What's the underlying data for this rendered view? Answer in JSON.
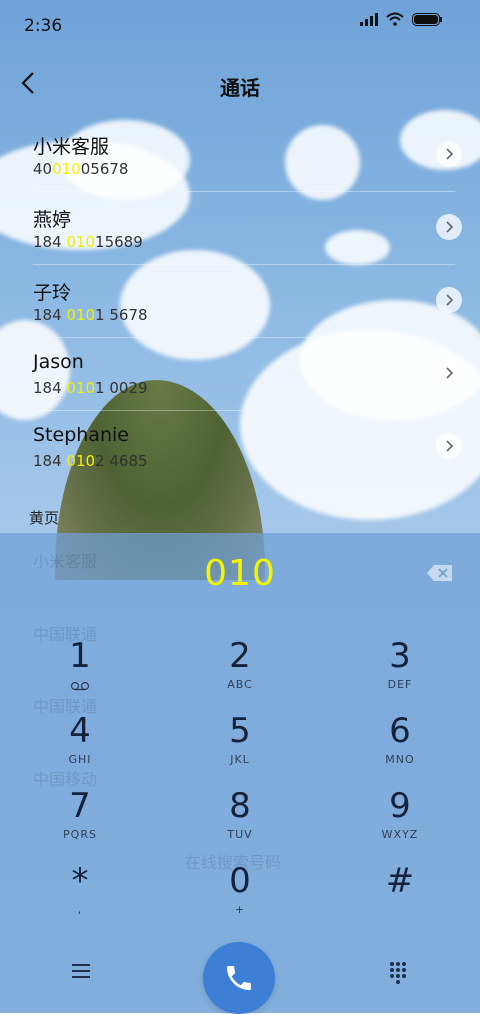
{
  "status": {
    "time": "2:36"
  },
  "header": {
    "title": "通话"
  },
  "contacts": [
    {
      "name": "小米客服",
      "num_pre": "40",
      "num_match": "010",
      "num_post": "05678"
    },
    {
      "name": "燕婷",
      "num_pre": "184 ",
      "num_match": "010",
      "num_post": "15689"
    },
    {
      "name": "子玲",
      "num_pre": "184 ",
      "num_match": "010",
      "num_post": "1 5678"
    },
    {
      "name": "Jason",
      "num_pre": "184 ",
      "num_match": "010",
      "num_post": "1 0029"
    },
    {
      "name": "Stephanie",
      "num_pre": "184 ",
      "num_match": "010",
      "num_post": "2 4685"
    }
  ],
  "section_label": "黄页",
  "background_faint": [
    "小米客服",
    "中国联通",
    "中国联通",
    "中国移动",
    "在线搜索号码"
  ],
  "dialer": {
    "input": "010",
    "keys": [
      {
        "digit": "1",
        "letters": ""
      },
      {
        "digit": "2",
        "letters": "ABC"
      },
      {
        "digit": "3",
        "letters": "DEF"
      },
      {
        "digit": "4",
        "letters": "GHI"
      },
      {
        "digit": "5",
        "letters": "JKL"
      },
      {
        "digit": "6",
        "letters": "MNO"
      },
      {
        "digit": "7",
        "letters": "PQRS"
      },
      {
        "digit": "8",
        "letters": "TUV"
      },
      {
        "digit": "9",
        "letters": "WXYZ"
      },
      {
        "digit": "*",
        "letters": ","
      },
      {
        "digit": "0",
        "letters": "+"
      },
      {
        "digit": "#",
        "letters": ""
      }
    ]
  },
  "icons": [
    "back-icon",
    "chevron-right-icon",
    "voicemail-icon",
    "backspace-icon",
    "menu-icon",
    "phone-icon",
    "dialpad-icon",
    "signal-icon",
    "wifi-icon",
    "battery-icon"
  ],
  "colors": {
    "highlight": "#f4f400",
    "call_button": "#3d7ed6"
  }
}
